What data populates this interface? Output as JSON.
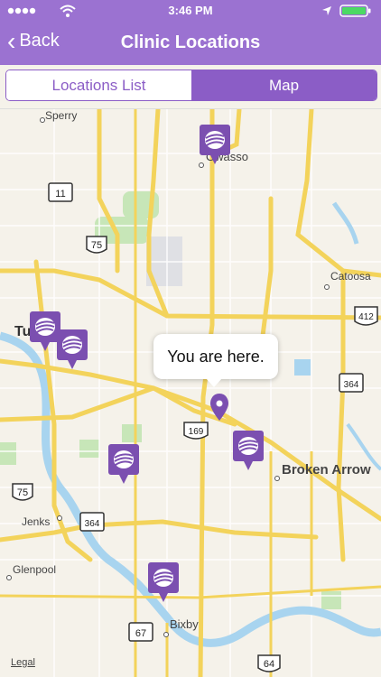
{
  "status": {
    "time": "3:46 PM"
  },
  "nav": {
    "back_label": "Back",
    "title": "Clinic Locations"
  },
  "segments": {
    "list_label": "Locations List",
    "map_label": "Map",
    "selected": "Map"
  },
  "map": {
    "callout_text": "You are here.",
    "labels": {
      "sperry": "Sperry",
      "owasso": "Owasso",
      "catoosa": "Catoosa",
      "tulsa": "Tulsa",
      "broken_arrow": "Broken Arrow",
      "jenks": "Jenks",
      "glenpool": "Glenpool",
      "bixby": "Bixby"
    },
    "shields": {
      "h11": "11",
      "h75a": "75",
      "h412": "412",
      "h364a": "364",
      "h169": "169",
      "h75b": "75",
      "h364b": "364",
      "h67": "67",
      "h64": "64"
    },
    "legal": "Legal"
  },
  "colors": {
    "brand": "#9b72d1",
    "pin": "#7b4fb0",
    "road": "#f3d35b",
    "water": "#a8d4ef",
    "park": "#c7e6b8"
  }
}
